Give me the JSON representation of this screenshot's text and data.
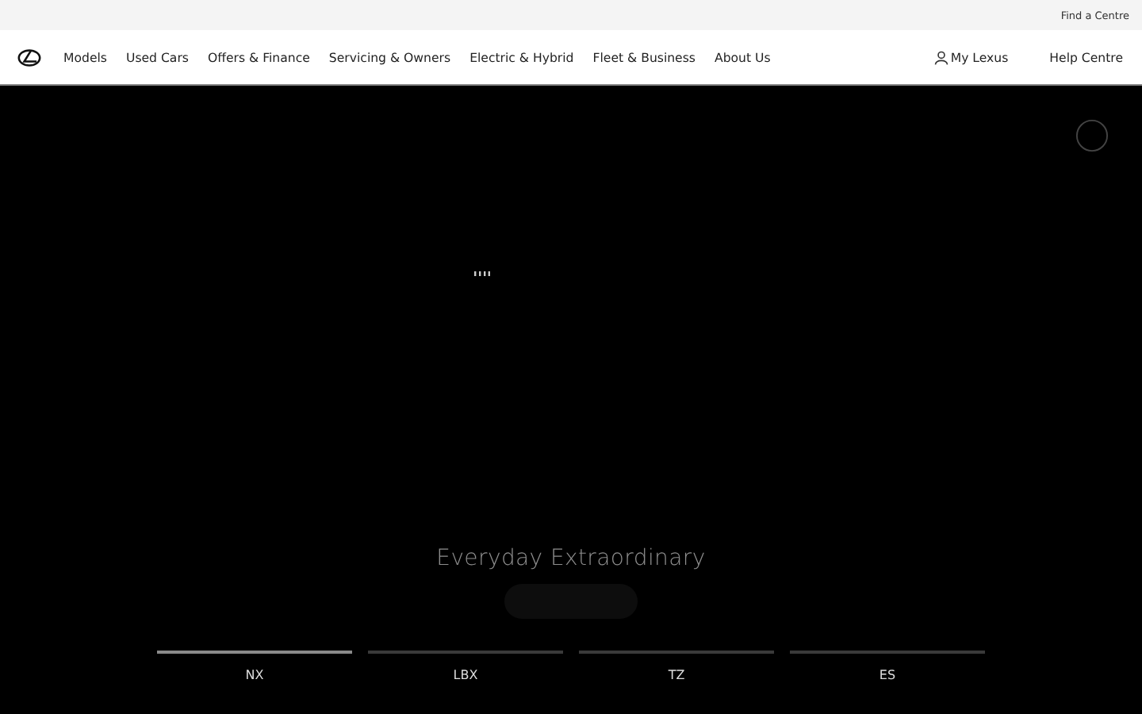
{
  "utility_bar": {
    "link": "Find a Centre"
  },
  "nav": {
    "items": [
      "Models",
      "Used Cars",
      "Offers & Finance",
      "Servicing & Owners",
      "Electric & Hybrid",
      "Fleet & Business",
      "About Us"
    ],
    "account": "My Lexus",
    "help": "Help Centre"
  },
  "hero": {
    "headline": "Everyday Extraordinary"
  },
  "model_tabs": [
    {
      "label": "NX",
      "selected": true
    },
    {
      "label": "LBX",
      "selected": false
    },
    {
      "label": "TZ",
      "selected": false
    },
    {
      "label": "ES",
      "selected": false
    }
  ]
}
